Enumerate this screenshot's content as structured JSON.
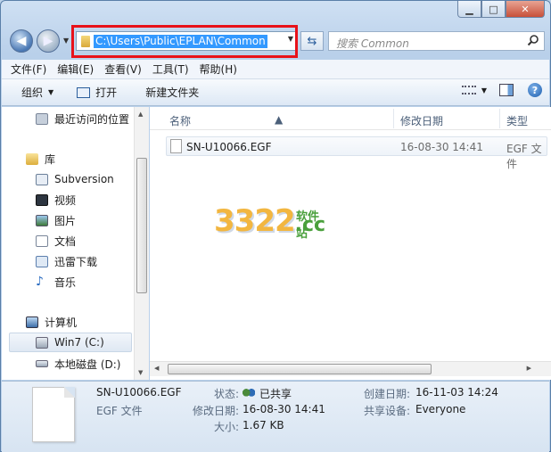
{
  "address": {
    "path": "C:\\Users\\Public\\EPLAN\\Common"
  },
  "search": {
    "placeholder": "搜索 Common"
  },
  "menu": [
    "文件(F)",
    "编辑(E)",
    "查看(V)",
    "工具(T)",
    "帮助(H)"
  ],
  "toolbar": {
    "organize": "组织",
    "open": "打开",
    "new_folder": "新建文件夹"
  },
  "nav": {
    "recent": "最近访问的位置",
    "libraries": "库",
    "subversion": "Subversion",
    "videos": "视频",
    "pictures": "图片",
    "documents": "文档",
    "thunder": "迅雷下载",
    "music": "音乐",
    "computer": "计算机",
    "drive_c": "Win7 (C:)",
    "drive_d": "本地磁盘 (D:)"
  },
  "columns": {
    "name": "名称",
    "modified": "修改日期",
    "type": "类型"
  },
  "files": [
    {
      "name": "SN-U10066.EGF",
      "modified": "16-08-30 14:41",
      "type": "EGF 文件"
    }
  ],
  "watermark": {
    "number": "3322",
    "domain": ".cc",
    "site": "软件站"
  },
  "details": {
    "file_name": "SN-U10066.EGF",
    "file_type": "EGF 文件",
    "status_label": "状态:",
    "status_value": "已共享",
    "modified_label": "修改日期:",
    "modified_value": "16-08-30 14:41",
    "size_label": "大小:",
    "size_value": "1.67 KB",
    "created_label": "创建日期:",
    "created_value": "16-11-03 14:24",
    "shared_label": "共享设备:",
    "shared_value": "Everyone"
  },
  "colors": {
    "highlight_border": "#e8121a",
    "selection": "#3399ff"
  }
}
